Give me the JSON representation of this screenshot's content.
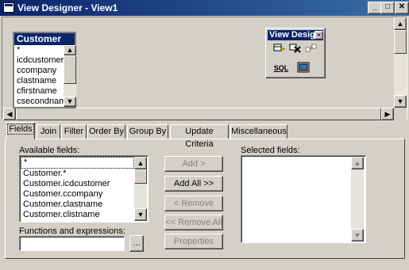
{
  "window": {
    "title": "View Designer - View1",
    "controls": [
      "_",
      "□",
      "✕"
    ]
  },
  "table": {
    "name": "Customer",
    "fields": [
      "*",
      "icdcustomer",
      "ccompany",
      "clastname",
      "cfirstname",
      "csecondname"
    ]
  },
  "toolbar": {
    "title": "View Desig",
    "close": "✕",
    "sql_label": "SQL"
  },
  "tabs": [
    "Fields",
    "Join",
    "Filter",
    "Order By",
    "Group By",
    "Update Criteria",
    "Miscellaneous"
  ],
  "fields_tab": {
    "available_label": "Available fields:",
    "available": [
      "*",
      "Customer.*",
      "Customer.icdcustomer",
      "Customer.ccompany",
      "Customer.clastname",
      "Customer.clistname"
    ],
    "selected_label": "Selected fields:",
    "functions_label": "Functions and expressions:",
    "functions_value": "",
    "browse_label": "...",
    "buttons": {
      "add": "Add >",
      "add_all": "Add All >>",
      "remove": "< Remove",
      "remove_all": "<< Remove All",
      "properties": "Properties"
    }
  }
}
